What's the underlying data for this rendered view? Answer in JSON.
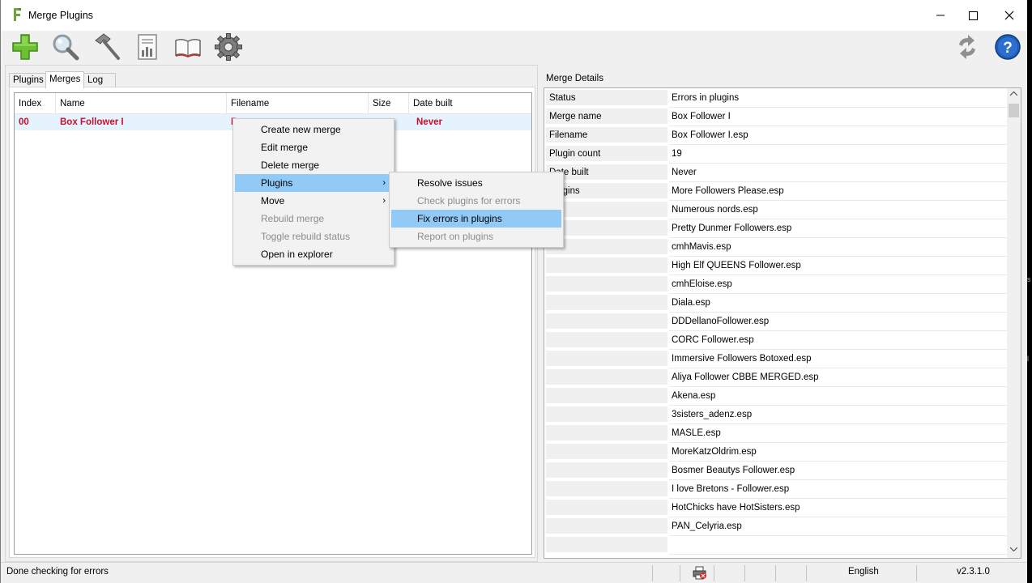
{
  "window": {
    "title": "Merge Plugins"
  },
  "toolbar": {
    "buttons": [
      {
        "name": "add-icon"
      },
      {
        "name": "search-icon"
      },
      {
        "name": "hammer-icon"
      },
      {
        "name": "report-icon"
      },
      {
        "name": "book-icon"
      },
      {
        "name": "gear-icon"
      }
    ],
    "right_buttons": [
      {
        "name": "refresh-icon"
      },
      {
        "name": "help-icon"
      }
    ]
  },
  "tabs": [
    {
      "label": "Plugins"
    },
    {
      "label": "Merges",
      "active": true
    },
    {
      "label": "Log"
    }
  ],
  "merges_table": {
    "columns": [
      "Index",
      "Name",
      "Filename",
      "Size",
      "Date built"
    ],
    "rows": [
      {
        "index": "00",
        "name": "Box Follower I",
        "filename": "B",
        "size": "",
        "date_built": "Never"
      }
    ],
    "row_color": "#c8102e"
  },
  "context_menu": {
    "items": [
      {
        "label": "Create new merge"
      },
      {
        "label": "Edit merge"
      },
      {
        "label": "Delete merge"
      },
      {
        "label": "Plugins",
        "submenu": true,
        "highlighted": true
      },
      {
        "label": "Move",
        "submenu": true
      },
      {
        "label": "Rebuild merge",
        "disabled": true
      },
      {
        "label": "Toggle rebuild status",
        "disabled": true
      },
      {
        "label": "Open in explorer"
      }
    ]
  },
  "submenu": {
    "items": [
      {
        "label": "Resolve issues"
      },
      {
        "label": "Check plugins for errors",
        "disabled": true
      },
      {
        "label": "Fix errors in plugins",
        "highlighted": true
      },
      {
        "label": "Report on plugins",
        "disabled": true
      }
    ]
  },
  "details": {
    "title": "Merge Details",
    "rows": [
      {
        "key": "Status",
        "value": "Errors in plugins"
      },
      {
        "key": "Merge name",
        "value": "Box Follower I"
      },
      {
        "key": "Filename",
        "value": "Box Follower I.esp"
      },
      {
        "key": "Plugin count",
        "value": "19"
      },
      {
        "key": "Date built",
        "value": "Never"
      },
      {
        "key": "Plugins",
        "value": "More Followers Please.esp"
      },
      {
        "key": "",
        "value": "Numerous nords.esp"
      },
      {
        "key": "",
        "value": "Pretty Dunmer Followers.esp"
      },
      {
        "key": "",
        "value": "cmhMavis.esp"
      },
      {
        "key": "",
        "value": "High Elf QUEENS Follower.esp"
      },
      {
        "key": "",
        "value": "cmhEloise.esp"
      },
      {
        "key": "",
        "value": "Diala.esp"
      },
      {
        "key": "",
        "value": "DDDellanoFollower.esp"
      },
      {
        "key": "",
        "value": "CORC Follower.esp"
      },
      {
        "key": "",
        "value": "Immersive Followers Botoxed.esp"
      },
      {
        "key": "",
        "value": "Aliya Follower CBBE MERGED.esp"
      },
      {
        "key": "",
        "value": "Akena.esp"
      },
      {
        "key": "",
        "value": "3sisters_adenz.esp"
      },
      {
        "key": "",
        "value": "MASLE.esp"
      },
      {
        "key": "",
        "value": "MoreKatzOldrim.esp"
      },
      {
        "key": "",
        "value": "Bosmer Beautys Follower.esp"
      },
      {
        "key": "",
        "value": "I love Bretons - Follower.esp"
      },
      {
        "key": "",
        "value": "HotChicks have HotSisters.esp"
      },
      {
        "key": "",
        "value": "PAN_Celyria.esp"
      },
      {
        "key": "",
        "value": ""
      }
    ]
  },
  "statusbar": {
    "message": "Done checking for errors",
    "language": "English",
    "version": "v2.3.1.0"
  }
}
